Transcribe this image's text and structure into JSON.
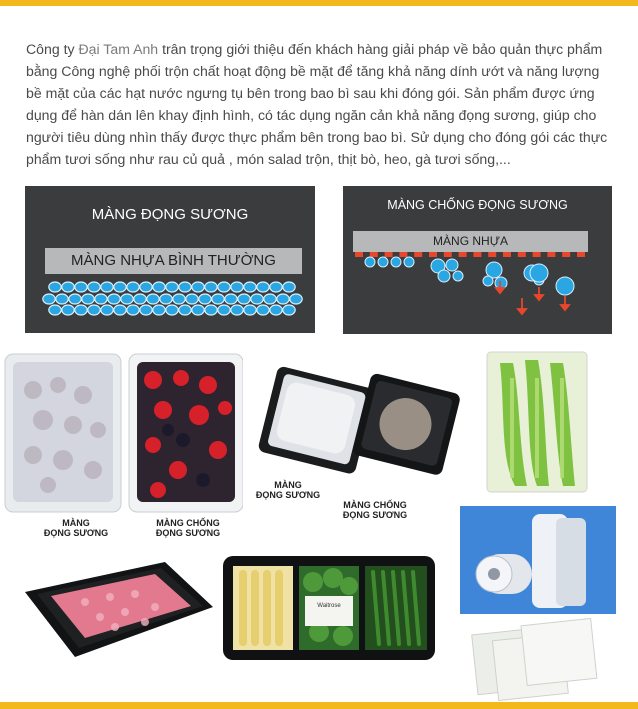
{
  "intro": {
    "prefix": "Công ty ",
    "brand": "Đại Tam Anh",
    "body": " trân trọng giới thiệu đến khách hàng giải pháp về bảo quản thực phẩm bằng Công nghệ phối trộn chất hoạt động bề mặt để tăng khả năng dính ướt và năng lượng bề mặt của các hạt nước ngưng tụ bên trong bao bì sau khi đóng gói. Sản phẩm được ứng dụng để hàn dán lên khay định hình, có tác dụng ngăn cản khả năng đọng sương, giúp cho người tiêu dùng nhìn thấy được thực phẩm bên trong bao bì. Sử dụng cho đóng gói các thực phẩm tươi sống như rau củ quả , món salad trộn, thịt bò, heo, gà tươi sống,..."
  },
  "diagram_left": {
    "title": "MÀNG ĐỌNG SƯƠNG",
    "film_label": "MÀNG NHỰA  BÌNH THƯỜNG"
  },
  "diagram_right": {
    "title": "MÀNG CHỐNG ĐỌNG SƯƠNG",
    "film_label": "MÀNG NHỰA"
  },
  "captions": {
    "berries_left": [
      "MÀNG",
      "ĐỌNG SƯƠNG"
    ],
    "berries_right": [
      "MÀNG CHỐNG",
      "ĐỌNG SƯƠNG"
    ],
    "tray_left": [
      "MÀNG",
      "ĐỌNG SƯƠNG"
    ],
    "tray_right": [
      "MÀNG CHỐNG",
      "ĐỌNG SƯƠNG"
    ]
  },
  "package_label": "Waitrose",
  "colors": {
    "accent_bar": "#f3b81c",
    "panel_bg": "#3b3c3e",
    "film_gray": "#b7b8ba",
    "droplet_blue": "#2aa6e2",
    "anti_fog_red": "#e8472b"
  }
}
